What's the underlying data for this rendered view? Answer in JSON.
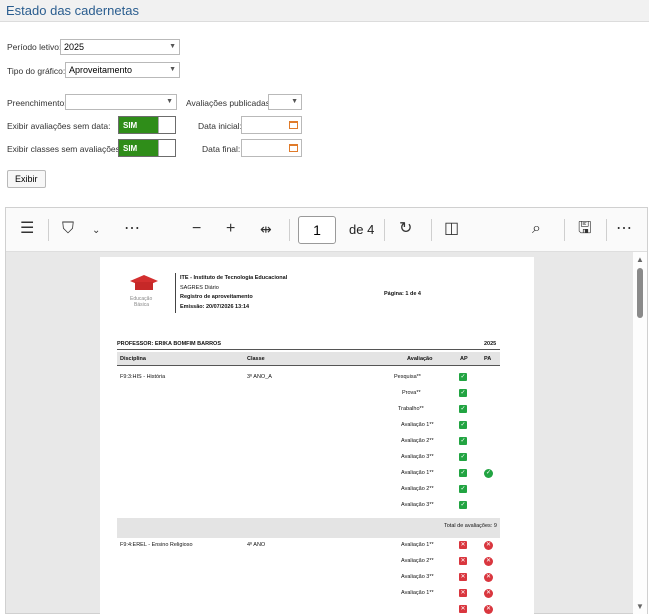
{
  "page": {
    "title": "Estado das cadernetas"
  },
  "form": {
    "periodo_label": "Período letivo:",
    "periodo_value": "2025",
    "tipo_label": "Tipo do gráfico:",
    "tipo_value": "Aproveitamento",
    "preenchimento_label": "Preenchimento:",
    "preenchimento_value": "",
    "avaliacoes_publicadas_label": "Avaliações publicadas:",
    "avaliacoes_publicadas_value": "",
    "exibir_sem_data_label": "Exibir avaliações sem data:",
    "exibir_sem_data_value": "SIM",
    "exibir_classes_label": "Exibir classes sem avaliações:",
    "exibir_classes_value": "SIM",
    "data_inicial_label": "Data inicial:",
    "data_final_label": "Data final:",
    "exibir_button": "Exibir"
  },
  "viewer": {
    "current_page": "1",
    "of_pages": "de 4",
    "icons": [
      "list-icon",
      "highlighter-icon",
      "more-icon",
      "zoom-out-icon",
      "zoom-in-icon",
      "fit-width-icon",
      "rotate-icon",
      "page-view-icon",
      "search-icon",
      "save-icon",
      "more-options-icon"
    ]
  },
  "report": {
    "logo_text_1": "Educação",
    "logo_text_2": "Básica",
    "institution": "ITE - Instituto de Tecnologia Educacional",
    "system": "SAGRES Diário",
    "report_name": "Registro de aproveitamento",
    "emission": "Emissão: 20/07/2026 13:14",
    "page_info": "Página: 1 de 4",
    "professor": "PROFESSOR: ERIKA BOMFIM BARROS",
    "year": "2025",
    "columns": {
      "disciplina": "Disciplina",
      "classe": "Classe",
      "avaliacao": "Avaliação",
      "ap": "AP",
      "pa": "PA"
    },
    "group1": {
      "disciplina": "F9:3:HIS - História",
      "classe": "3º ANO_A",
      "rows": [
        "Pesquisa**",
        "Prova**",
        "Trabalho**",
        "Avaliação 1**",
        "Avaliação 2**",
        "Avaliação 3**",
        "Avaliação 1**",
        "Avaliação 2**",
        "Avaliação 3**"
      ],
      "total": "Total de avaliações: 9"
    },
    "group2": {
      "disciplina": "F9:4:EREL - Ensino Religioso",
      "classe": "4º ANO",
      "rows": [
        "Avaliação 1**",
        "Avaliação 2**",
        "Avaliação 3**",
        "Avaliação 1**"
      ]
    }
  },
  "colors": {
    "title": "#2a5d8f",
    "toggle_on": "#2f8d19",
    "check": "#22a442",
    "cross": "#d9363e"
  }
}
